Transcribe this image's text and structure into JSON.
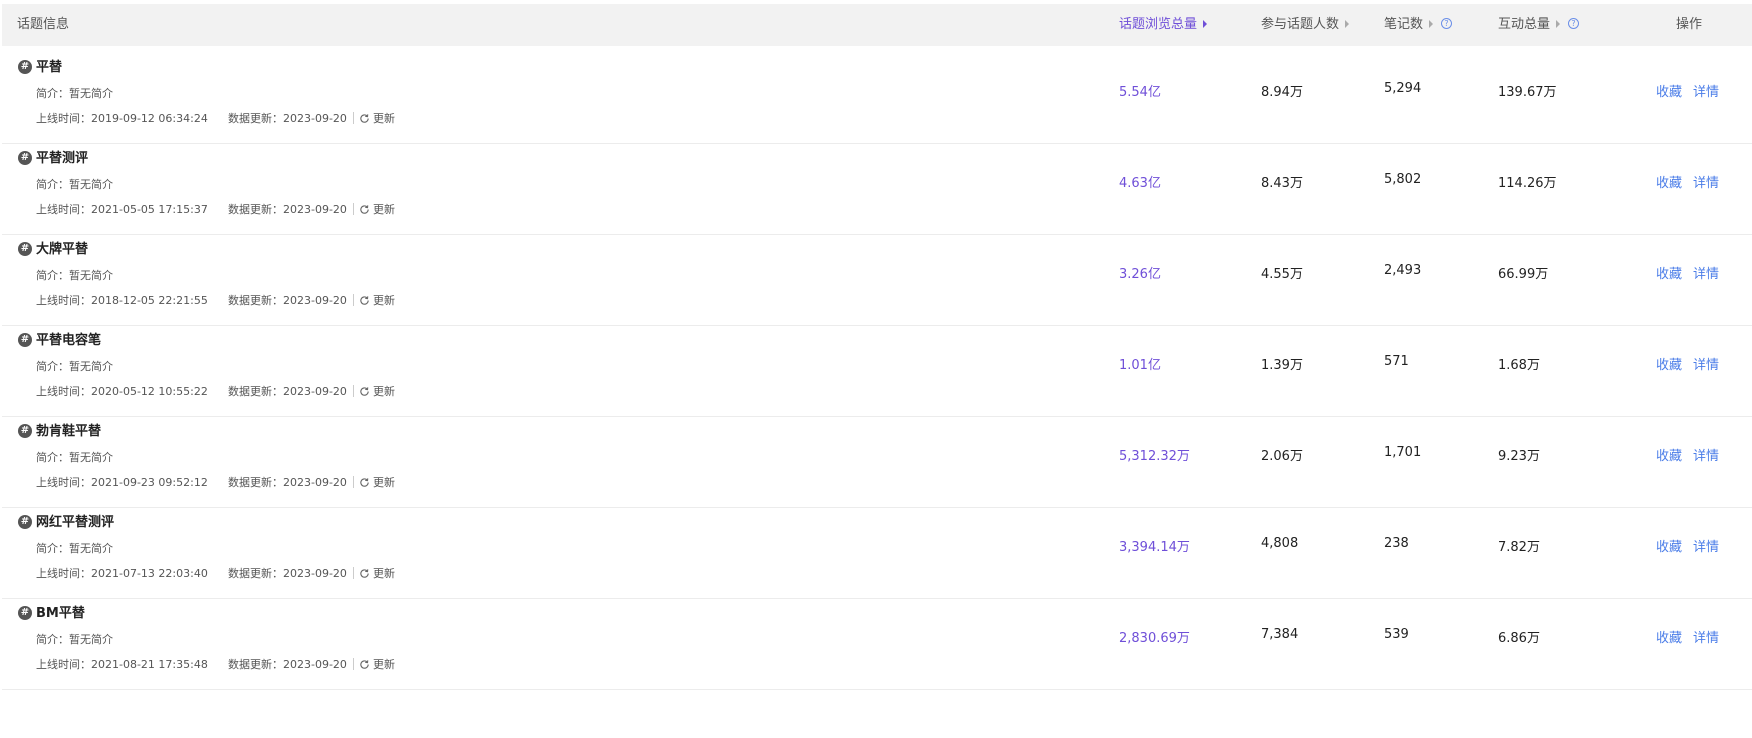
{
  "header": {
    "topic_info": "话题信息",
    "views_total": "话题浏览总量",
    "participants": "参与话题人数",
    "notes": "笔记数",
    "interactions_total": "互动总量",
    "actions": "操作",
    "help_glyph": "?",
    "active_color": "#6f4fd8"
  },
  "labels": {
    "intro_prefix": "简介：",
    "online_prefix": "上线时间：",
    "updated_prefix": "数据更新：",
    "refresh": "更新",
    "favorite": "收藏",
    "detail": "详情",
    "topic_glyph": "#"
  },
  "rows": [
    {
      "name": "平替",
      "intro": "暂无简介",
      "online": "2019-09-12 06:34:24",
      "updated": "2023-09-20",
      "views": "5.54亿",
      "participants": "8.94万",
      "notes": "5,294",
      "interactions": "139.67万"
    },
    {
      "name": "平替测评",
      "intro": "暂无简介",
      "online": "2021-05-05 17:15:37",
      "updated": "2023-09-20",
      "views": "4.63亿",
      "participants": "8.43万",
      "notes": "5,802",
      "interactions": "114.26万"
    },
    {
      "name": "大牌平替",
      "intro": "暂无简介",
      "online": "2018-12-05 22:21:55",
      "updated": "2023-09-20",
      "views": "3.26亿",
      "participants": "4.55万",
      "notes": "2,493",
      "interactions": "66.99万"
    },
    {
      "name": "平替电容笔",
      "intro": "暂无简介",
      "online": "2020-05-12 10:55:22",
      "updated": "2023-09-20",
      "views": "1.01亿",
      "participants": "1.39万",
      "notes": "571",
      "interactions": "1.68万"
    },
    {
      "name": "勃肯鞋平替",
      "intro": "暂无简介",
      "online": "2021-09-23 09:52:12",
      "updated": "2023-09-20",
      "views": "5,312.32万",
      "participants": "2.06万",
      "notes": "1,701",
      "interactions": "9.23万"
    },
    {
      "name": "网红平替测评",
      "intro": "暂无简介",
      "online": "2021-07-13 22:03:40",
      "updated": "2023-09-20",
      "views": "3,394.14万",
      "participants": "4,808",
      "notes": "238",
      "interactions": "7.82万"
    },
    {
      "name": "BM平替",
      "intro": "暂无简介",
      "online": "2021-08-21 17:35:48",
      "updated": "2023-09-20",
      "views": "2,830.69万",
      "participants": "7,384",
      "notes": "539",
      "interactions": "6.86万"
    }
  ]
}
